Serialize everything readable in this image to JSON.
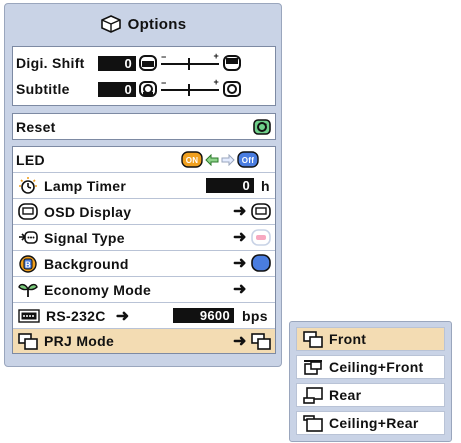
{
  "menu": {
    "title": "Options",
    "digi_shift": {
      "label": "Digi. Shift",
      "value": "0"
    },
    "subtitle": {
      "label": "Subtitle",
      "value": "0"
    },
    "reset": {
      "label": "Reset"
    },
    "led": {
      "label": "LED",
      "on_label": "ON",
      "off_label": "Off"
    },
    "lamp_timer": {
      "label": "Lamp Timer",
      "value": "0",
      "unit": "h"
    },
    "osd_display": {
      "label": "OSD Display"
    },
    "signal_type": {
      "label": "Signal Type"
    },
    "background": {
      "label": "Background"
    },
    "economy_mode": {
      "label": "Economy Mode"
    },
    "rs232c": {
      "label": "RS-232C",
      "value": "9600",
      "unit": "bps"
    },
    "prj_mode": {
      "label": "PRJ Mode"
    }
  },
  "slider_signs": {
    "minus": "−",
    "plus": "+"
  },
  "arrow_glyph": "➜",
  "submenu": {
    "options": [
      "Front",
      "Ceiling+Front",
      "Rear",
      "Ceiling+Rear"
    ],
    "selected_index": 0
  },
  "colors": {
    "menu_bg": "#c9d3e6",
    "selected_row": "#f3dcb3",
    "accent_orange": "#f0a020",
    "accent_blue": "#4a7de0"
  }
}
